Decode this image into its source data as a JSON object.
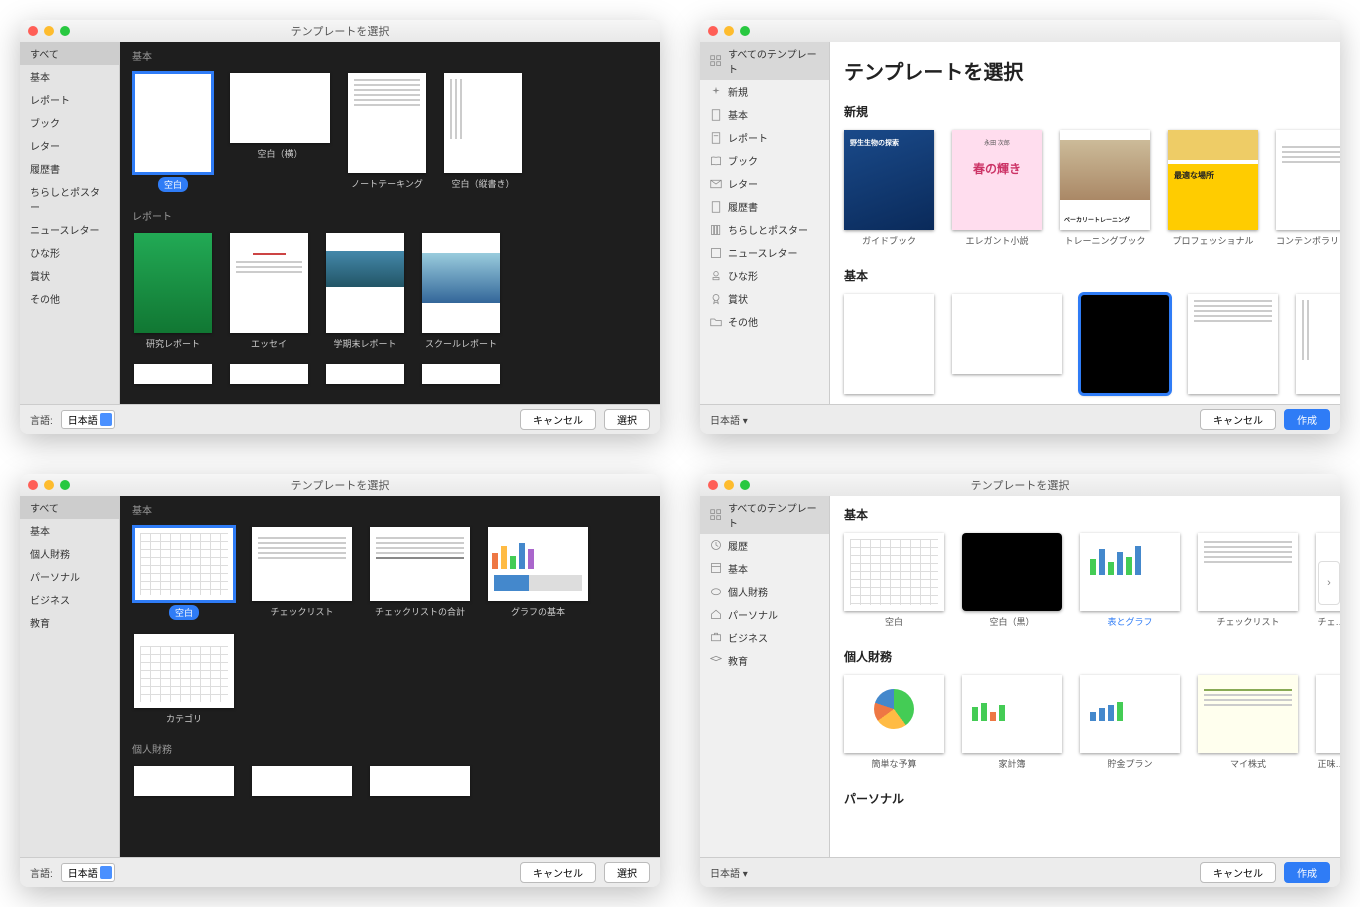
{
  "windows": {
    "tl": {
      "title": "テンプレートを選択",
      "sidebar": [
        "すべて",
        "基本",
        "レポート",
        "ブック",
        "レター",
        "履歴書",
        "ちらしとポスター",
        "ニュースレター",
        "ひな形",
        "賞状",
        "その他"
      ],
      "sections": [
        {
          "header": "基本",
          "items": [
            "空白",
            "空白（横）",
            "ノートテーキング",
            "空白（縦書き）"
          ]
        },
        {
          "header": "レポート",
          "items": [
            "研究レポート",
            "エッセイ",
            "学期末レポート",
            "スクールレポート"
          ]
        }
      ],
      "lang_label": "言語:",
      "lang_value": "日本語",
      "cancel": "キャンセル",
      "select": "選択"
    },
    "tr": {
      "title": "テンプレートを選択",
      "sidebar": [
        "すべてのテンプレート",
        "新規",
        "基本",
        "レポート",
        "ブック",
        "レター",
        "履歴書",
        "ちらしとポスター",
        "ニュースレター",
        "ひな形",
        "賞状",
        "その他"
      ],
      "heading": "テンプレートを選択",
      "sections": [
        {
          "header": "新規",
          "items": [
            "ガイドブック",
            "エレガント小説",
            "トレーニングブック",
            "プロフェッショナル",
            "コンテンポラリレター"
          ]
        },
        {
          "header": "基本",
          "items": [
            "",
            "",
            "",
            "",
            ""
          ]
        }
      ],
      "thumb_text": {
        "guide": "野生生物の探索",
        "novel": "春の輝き",
        "novel_sub": "永田 次郎",
        "training": "ベーカリートレーニング",
        "pro": "最適な場所"
      },
      "lang_value": "日本語",
      "cancel": "キャンセル",
      "create": "作成"
    },
    "bl": {
      "title": "テンプレートを選択",
      "sidebar": [
        "すべて",
        "基本",
        "個人財務",
        "パーソナル",
        "ビジネス",
        "教育"
      ],
      "sections": [
        {
          "header": "基本",
          "items": [
            "空白",
            "チェックリスト",
            "チェックリストの合計",
            "グラフの基本",
            "カテゴリ"
          ]
        },
        {
          "header": "個人財務",
          "items": [
            "",
            "",
            ""
          ]
        }
      ],
      "lang_label": "言語:",
      "lang_value": "日本語",
      "cancel": "キャンセル",
      "select": "選択"
    },
    "br": {
      "title": "テンプレートを選択",
      "sidebar": [
        "すべてのテンプレート",
        "履歴",
        "基本",
        "個人財務",
        "パーソナル",
        "ビジネス",
        "教育"
      ],
      "sections": [
        {
          "header": "基本",
          "items": [
            "空白",
            "空白（黒）",
            "表とグラフ",
            "チェックリスト",
            "チェ…"
          ]
        },
        {
          "header": "個人財務",
          "items": [
            "簡単な予算",
            "家計簿",
            "貯金プラン",
            "マイ株式",
            "正味…"
          ]
        },
        {
          "header": "パーソナル",
          "items": []
        }
      ],
      "lang_value": "日本語",
      "cancel": "キャンセル",
      "create": "作成"
    }
  }
}
